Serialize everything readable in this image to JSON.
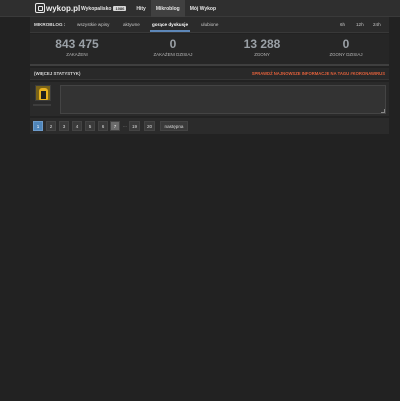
{
  "header": {
    "logo_text": "wykop.pl",
    "nav": [
      {
        "label": "Wykopalisko",
        "badge": "1086"
      },
      {
        "label": "Hity"
      },
      {
        "label": "Mikroblog",
        "active": true
      },
      {
        "label": "Mój Wykop"
      }
    ]
  },
  "filters": {
    "title": "MIKROBLOG :",
    "tabs": [
      "wszystkie wpisy",
      "aktywne",
      "gorące dyskusje",
      "ulubione"
    ],
    "active_tab": "gorące dyskusje",
    "time_tabs": [
      "6h",
      "12h",
      "24h"
    ]
  },
  "stats": [
    {
      "value": "843 475",
      "label": "ZAKAŻENI"
    },
    {
      "value": "0",
      "label": "ZAKAŻENI DZISIAJ"
    },
    {
      "value": "13 288",
      "label": "ZGONY"
    },
    {
      "value": "0",
      "label": "ZGONY DZISIAJ"
    }
  ],
  "info": {
    "tag_link": "(WIĘCEJ STATYSTYK)",
    "promo_link": "SPRAWDŹ NAJNOWSZE INFORMACJE NA TAGU #KORONAWIRUS"
  },
  "compose": {
    "placeholder": ""
  },
  "pagination": {
    "pages": [
      "1",
      "2",
      "3",
      "4",
      "5",
      "6",
      "7"
    ],
    "ellipsis": "...",
    "far_pages": [
      "19",
      "20"
    ],
    "next_label": "następna",
    "active_page": "1"
  },
  "colors": {
    "background": "#222222",
    "accent_blue": "#4f86bb",
    "promo_orange": "#e0603b"
  }
}
